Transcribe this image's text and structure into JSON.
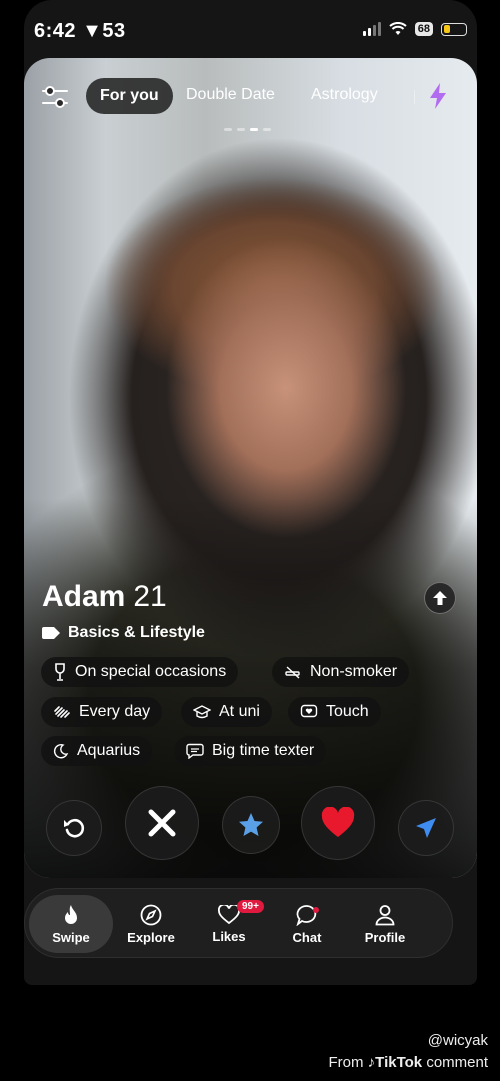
{
  "status_bar": {
    "time": "6:42",
    "time_suffix": "53",
    "battery_badge": "68"
  },
  "top_nav": {
    "tabs": [
      "For you",
      "Double Date",
      "Astrology"
    ]
  },
  "profile": {
    "name": "Adam",
    "age": "21",
    "section": "Basics & Lifestyle",
    "tags": [
      {
        "label": "On special occasions",
        "icon": "wine-glass-icon"
      },
      {
        "label": "Non-smoker",
        "icon": "no-smoking-icon"
      },
      {
        "label": "Every day",
        "icon": "dumbbell-icon"
      },
      {
        "label": "At uni",
        "icon": "graduation-cap-icon"
      },
      {
        "label": "Touch",
        "icon": "touch-icon"
      },
      {
        "label": "Aquarius",
        "icon": "moon-icon"
      },
      {
        "label": "Big time texter",
        "icon": "chat-bubble-icon"
      }
    ]
  },
  "actions": [
    "rewind-icon",
    "nope-x-icon",
    "super-like-star-icon",
    "like-heart-icon",
    "boost-send-icon"
  ],
  "tab_bar": {
    "items": [
      "Swipe",
      "Explore",
      "Likes",
      "Chat",
      "Profile"
    ],
    "likes_badge": "99+"
  },
  "watermark": {
    "handle": "@wicyak",
    "from": "From",
    "brand": "TikTok",
    "comment": "comment"
  },
  "colors": {
    "like": "#e8192c",
    "star": "#5aa0e6",
    "boost": "#3f8df0",
    "bolt": "#b26cf0",
    "badge": "#e0193f"
  }
}
